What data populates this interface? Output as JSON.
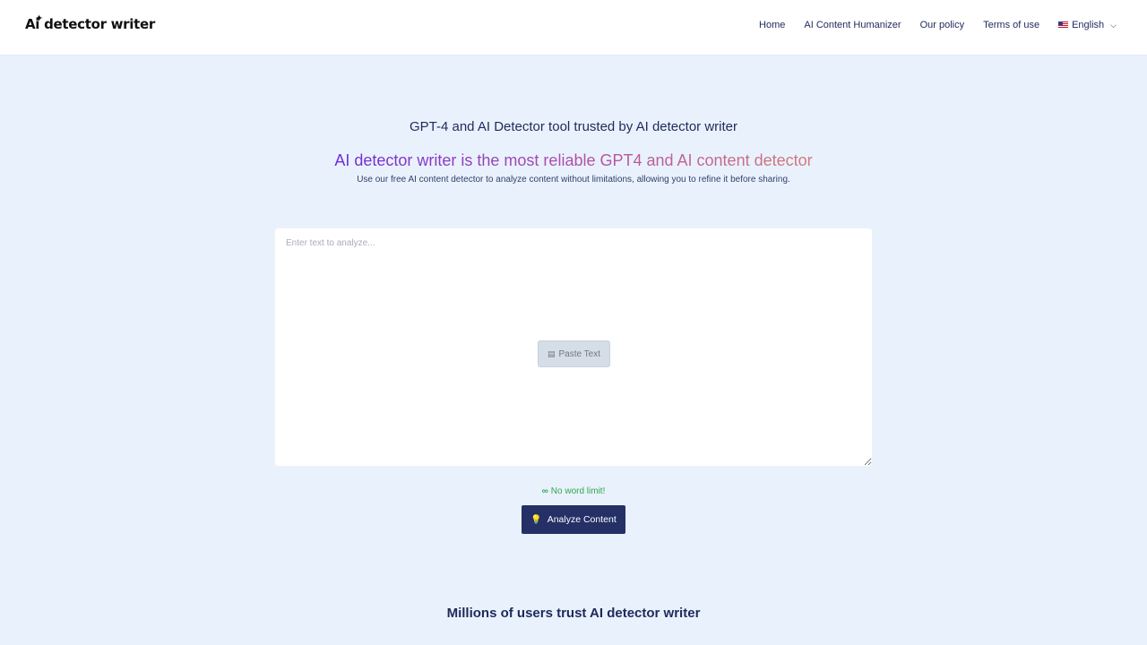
{
  "logo": {
    "text": "Ai detector writer",
    "icon": "sparkle-icon"
  },
  "nav": {
    "items": [
      "Home",
      "AI Content Humanizer",
      "Our policy",
      "Terms of use"
    ],
    "language": "English"
  },
  "hero": {
    "subheading": "GPT-4 and AI Detector tool trusted by AI detector writer",
    "title": "AI detector writer is the most reliable GPT4 and AI content detector",
    "description": "Use our free AI content detector to analyze content without limitations, allowing you to refine it before sharing."
  },
  "editor": {
    "placeholder": "Enter text to analyze...",
    "value": "",
    "paste_label": "Paste Text"
  },
  "word_limit": "No word limit!",
  "analyze_label": "Analyze Content",
  "trust_heading": "Millions of users trust AI detector writer",
  "colors": {
    "nav_text": "#1f2a5a",
    "primary_button": "#243066",
    "background": "#e9f2fc",
    "gradient_start": "#6c2bd9",
    "gradient_end": "#d37a7a",
    "success": "#2fa84f"
  }
}
